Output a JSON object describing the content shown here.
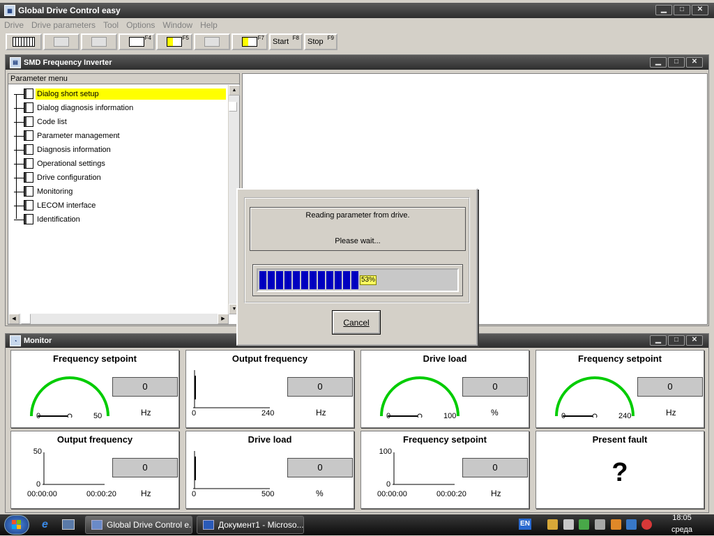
{
  "app": {
    "title": "Global Drive Control easy",
    "window_buttons": {
      "minimize": "▁",
      "maximize": "□",
      "close": "✕"
    }
  },
  "menu": [
    "Drive",
    "Drive parameters",
    "Tool",
    "Options",
    "Window",
    "Help"
  ],
  "toolbar": {
    "f4": "F4",
    "f5": "F5",
    "f7": "F7",
    "start_label": "Start",
    "start_key": "F8",
    "stop_label": "Stop",
    "stop_key": "F9"
  },
  "inner_window": {
    "title": "SMD Frequency Inverter",
    "tree_header": "Parameter menu",
    "items": [
      {
        "label": "Dialog short setup",
        "selected": true
      },
      {
        "label": "Dialog diagnosis information"
      },
      {
        "label": "Code list"
      },
      {
        "label": "Parameter management"
      },
      {
        "label": "Diagnosis information"
      },
      {
        "label": "Operational settings"
      },
      {
        "label": "Drive configuration"
      },
      {
        "label": "Monitoring"
      },
      {
        "label": "LECOM interface"
      },
      {
        "label": "Identification"
      }
    ]
  },
  "monitor": {
    "title": "Monitor",
    "panels": [
      {
        "title": "Frequency setpoint",
        "value": "0",
        "unit": "Hz",
        "min": "0",
        "max": "50"
      },
      {
        "title": "Output frequency",
        "value": "0",
        "unit": "Hz",
        "min": "0",
        "max": "240"
      },
      {
        "title": "Drive load",
        "value": "0",
        "unit": "%",
        "min": "0",
        "max": "100"
      },
      {
        "title": "Frequency setpoint",
        "value": "0",
        "unit": "Hz",
        "min": "0",
        "max": "240"
      },
      {
        "title": "Output frequency",
        "value": "0",
        "unit": "Hz",
        "ymax": "50",
        "ymin": "0",
        "t0": "00:00:00",
        "t1": "00:00:20"
      },
      {
        "title": "Drive load",
        "value": "0",
        "unit": "%",
        "min": "0",
        "max": "500"
      },
      {
        "title": "Frequency setpoint",
        "value": "0",
        "unit": "Hz",
        "ymax": "100",
        "ymin": "0",
        "t0": "00:00:00",
        "t1": "00:00:20"
      },
      {
        "title": "Present fault",
        "value": "?"
      }
    ]
  },
  "dialog": {
    "message_line1": "Reading parameter from drive.",
    "message_line2": "Please wait...",
    "progress_fraction": 0.53,
    "progress_label": "53%",
    "cancel_label": "Cancel"
  },
  "taskbar": {
    "tasks": [
      "Global Drive Control e...",
      "Документ1 - Microso..."
    ],
    "lang": "EN",
    "time": "18:05",
    "day": "среда"
  },
  "colors": {
    "highlight": "#ffff00",
    "progress": "#0000c0",
    "gauge": "#00cc00"
  }
}
